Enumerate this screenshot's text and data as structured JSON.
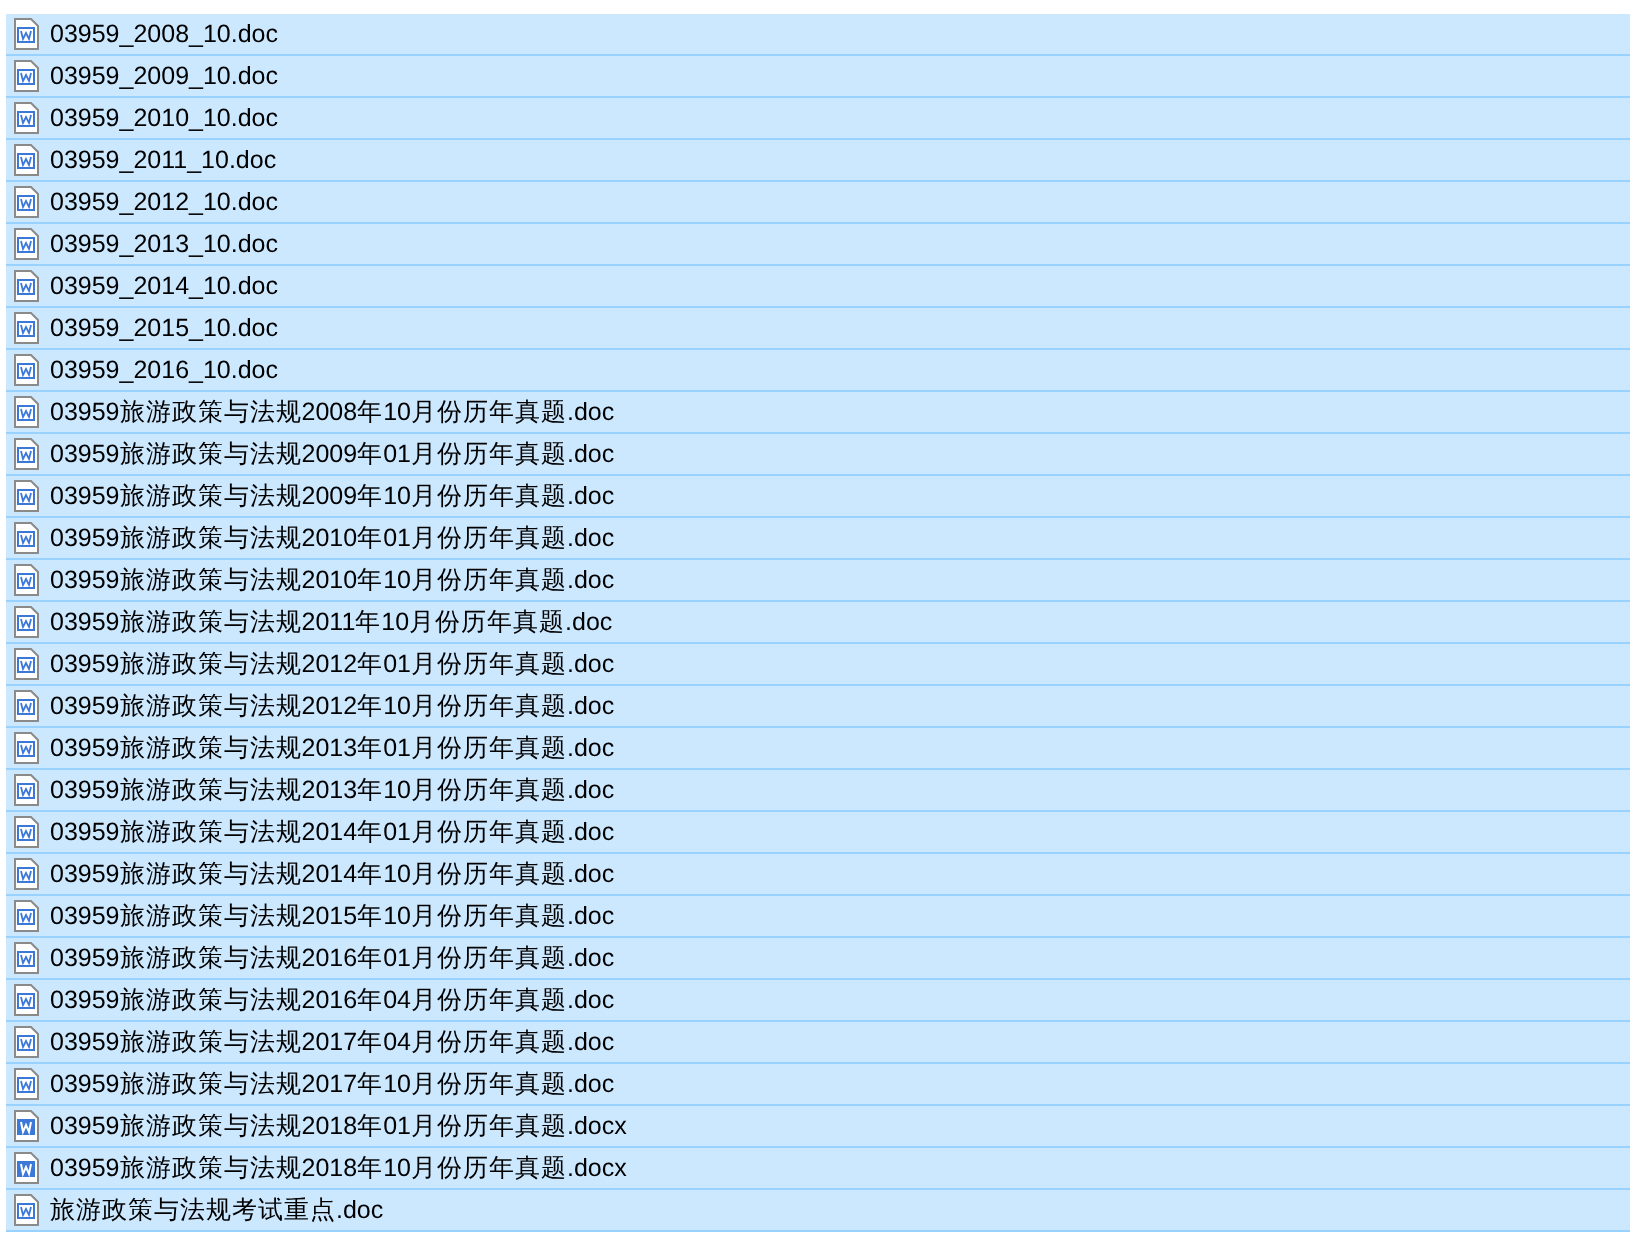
{
  "files": [
    {
      "name": "03959_2008_10.doc",
      "kind": "doc",
      "selected": true
    },
    {
      "name": "03959_2009_10.doc",
      "kind": "doc",
      "selected": true
    },
    {
      "name": "03959_2010_10.doc",
      "kind": "doc",
      "selected": true
    },
    {
      "name": "03959_2011_10.doc",
      "kind": "doc",
      "selected": true
    },
    {
      "name": "03959_2012_10.doc",
      "kind": "doc",
      "selected": true
    },
    {
      "name": "03959_2013_10.doc",
      "kind": "doc",
      "selected": true
    },
    {
      "name": "03959_2014_10.doc",
      "kind": "doc",
      "selected": true
    },
    {
      "name": "03959_2015_10.doc",
      "kind": "doc",
      "selected": true
    },
    {
      "name": "03959_2016_10.doc",
      "kind": "doc",
      "selected": true
    },
    {
      "name": "03959旅游政策与法规2008年10月份历年真题.doc",
      "kind": "doc",
      "selected": true
    },
    {
      "name": "03959旅游政策与法规2009年01月份历年真题.doc",
      "kind": "doc",
      "selected": true
    },
    {
      "name": "03959旅游政策与法规2009年10月份历年真题.doc",
      "kind": "doc",
      "selected": true
    },
    {
      "name": "03959旅游政策与法规2010年01月份历年真题.doc",
      "kind": "doc",
      "selected": true
    },
    {
      "name": "03959旅游政策与法规2010年10月份历年真题.doc",
      "kind": "doc",
      "selected": true
    },
    {
      "name": "03959旅游政策与法规2011年10月份历年真题.doc",
      "kind": "doc",
      "selected": true
    },
    {
      "name": "03959旅游政策与法规2012年01月份历年真题.doc",
      "kind": "doc",
      "selected": true
    },
    {
      "name": "03959旅游政策与法规2012年10月份历年真题.doc",
      "kind": "doc",
      "selected": true
    },
    {
      "name": "03959旅游政策与法规2013年01月份历年真题.doc",
      "kind": "doc",
      "selected": true
    },
    {
      "name": "03959旅游政策与法规2013年10月份历年真题.doc",
      "kind": "doc",
      "selected": true
    },
    {
      "name": "03959旅游政策与法规2014年01月份历年真题.doc",
      "kind": "doc",
      "selected": true
    },
    {
      "name": "03959旅游政策与法规2014年10月份历年真题.doc",
      "kind": "doc",
      "selected": true
    },
    {
      "name": "03959旅游政策与法规2015年10月份历年真题.doc",
      "kind": "doc",
      "selected": true
    },
    {
      "name": "03959旅游政策与法规2016年01月份历年真题.doc",
      "kind": "doc",
      "selected": true
    },
    {
      "name": "03959旅游政策与法规2016年04月份历年真题.doc",
      "kind": "doc",
      "selected": true
    },
    {
      "name": "03959旅游政策与法规2017年04月份历年真题.doc",
      "kind": "doc",
      "selected": true
    },
    {
      "name": "03959旅游政策与法规2017年10月份历年真题.doc",
      "kind": "doc",
      "selected": true
    },
    {
      "name": "03959旅游政策与法规2018年01月份历年真题.docx",
      "kind": "docx",
      "selected": true
    },
    {
      "name": "03959旅游政策与法规2018年10月份历年真题.docx",
      "kind": "docx",
      "selected": true
    },
    {
      "name": "旅游政策与法规考试重点.doc",
      "kind": "doc",
      "selected": true
    }
  ]
}
